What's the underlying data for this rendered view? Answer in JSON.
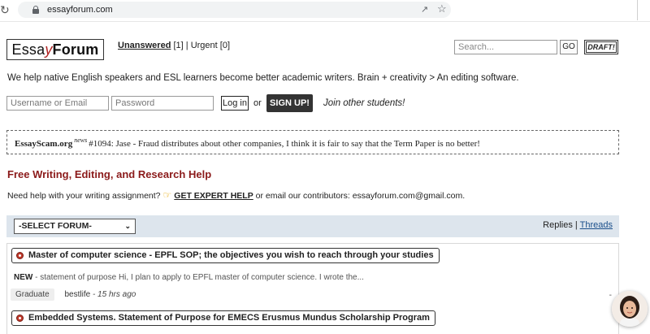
{
  "browser": {
    "url": "essayforum.com"
  },
  "logo": {
    "essay_pre": "Essa",
    "essay_y": "y",
    "forum": "Forum"
  },
  "top_links": {
    "unanswered": "Unanswered",
    "unanswered_count": "[1]",
    "separator": "|",
    "urgent": "Urgent [0]"
  },
  "search": {
    "placeholder": "Search...",
    "go_label": "GO",
    "draft_label": "DRAFT!"
  },
  "tagline": "We help native English speakers and ESL learners become better academic writers. Brain + creativity > An editing software.",
  "login": {
    "username_placeholder": "Username or Email",
    "password_placeholder": "Password",
    "login_label": "Log in",
    "or": "or",
    "signup_label": "SIGN UP!",
    "join_text": "Join other students!"
  },
  "news": {
    "site": "EssayScam.org",
    "tag": "news",
    "text": "#1094: Jase - Fraud distributes about other companies, I think it is fair to say that the Term Paper is no better!"
  },
  "help": {
    "heading": "Free Writing, Editing, and Research Help",
    "prefix": "Need help with your writing assignment?",
    "expert_link": "GET EXPERT HELP",
    "suffix": "or email our contributors: essayforum.com@gmail.com."
  },
  "forum_bar": {
    "select_value": "-SELECT FORUM-",
    "replies": "Replies",
    "separator": "|",
    "threads": "Threads"
  },
  "threads": [
    {
      "title": "Master of computer science - EPFL SOP; the objectives you wish to reach through your studies",
      "new_label": "NEW",
      "snippet": "- statement of purpose Hi, I plan to apply to EPFL master of computer science. I wrote the...",
      "badge": "Graduate",
      "author": "bestlife",
      "time": "- 15 hrs ago",
      "dash": "-"
    },
    {
      "title": "Embedded Systems. Statement of Purpose for EMECS Erusmus Mundus Scholarship Program"
    }
  ],
  "colors": {
    "heading_red": "#8b1a1a",
    "forum_bar_bg": "#dde5ed",
    "signup_bg": "#333333",
    "link_blue": "#1a4f8b"
  },
  "icons": [
    "reload-icon",
    "lock-icon",
    "share-icon",
    "star-icon",
    "thread-status-icon",
    "pointing-hand-icon",
    "select-chevron-icon"
  ]
}
